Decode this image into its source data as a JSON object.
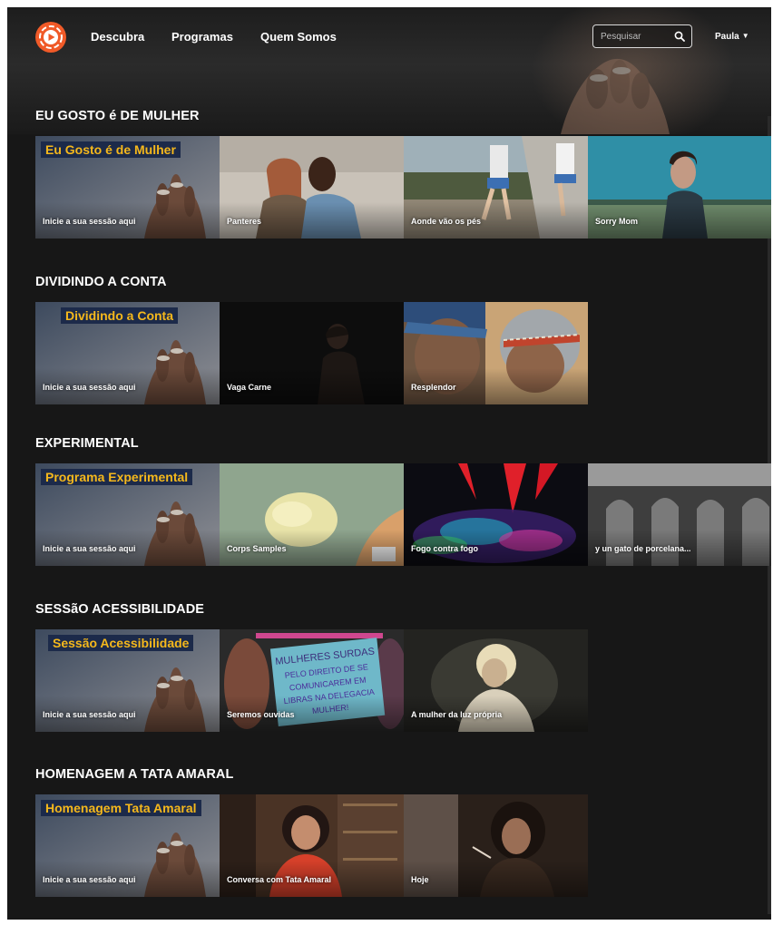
{
  "nav": {
    "items": [
      "Descubra",
      "Programas",
      "Quem Somos"
    ],
    "search_placeholder": "Pesquisar",
    "user_name": "Paula"
  },
  "colors": {
    "background": "#171717",
    "accent": "#f05a28",
    "program_title_text": "#f5b81c",
    "program_title_bg": "#1c2a4a"
  },
  "sections": [
    {
      "title": "EU GOSTO é DE MULHER",
      "program_title": "Eu Gosto é de Mulher",
      "cards": [
        "Inicie a sua sessão aqui",
        "Panteres",
        "Aonde vão os pés",
        "Sorry Mom"
      ]
    },
    {
      "title": "DIVIDINDO A CONTA",
      "program_title": "Dividindo a Conta",
      "cards": [
        "Inicie a sua sessão aqui",
        "Vaga Carne",
        "Resplendor"
      ]
    },
    {
      "title": "EXPERIMENTAL",
      "program_title": "Programa Experimental",
      "cards": [
        "Inicie a sua sessão aqui",
        "Corps Samples",
        "Fogo contra fogo",
        "y un gato de porcelana..."
      ]
    },
    {
      "title": "SESSãO ACESSIBILIDADE",
      "program_title": "Sessão Acessibilidade",
      "cards": [
        "Inicie a sua sessão aqui",
        "Seremos ouvidas",
        "A mulher da luz própria"
      ]
    },
    {
      "title": "HOMENAGEM A TATA AMARAL",
      "program_title": "Homenagem Tata Amaral",
      "cards": [
        "Inicie a sua sessão aqui",
        "Conversa com Tata Amaral",
        "Hoje"
      ]
    }
  ],
  "icons": {
    "logo": "play-logo-icon",
    "search": "search-icon",
    "caret": "caret-down-icon"
  },
  "thumbnails": {
    "seremos_ouvidas_sign": "MULHERES SURDAS PELO DIREITO DE SE COMUNICAREM EM LIBRAS NA DELEGACIA MULHER!"
  }
}
